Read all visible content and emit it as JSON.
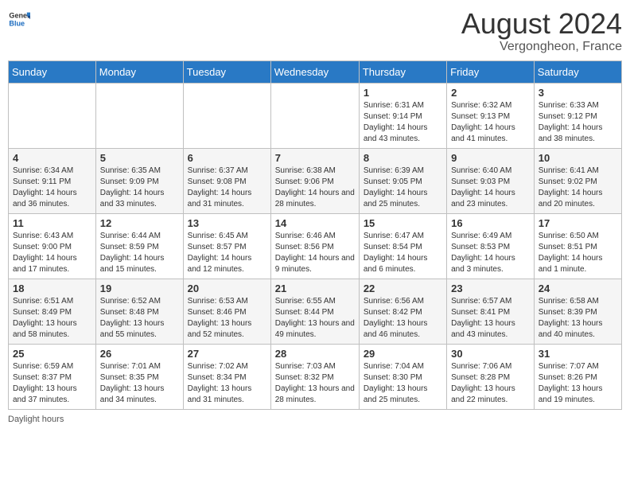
{
  "header": {
    "logo_general": "General",
    "logo_blue": "Blue",
    "month": "August 2024",
    "location": "Vergongheon, France"
  },
  "weekdays": [
    "Sunday",
    "Monday",
    "Tuesday",
    "Wednesday",
    "Thursday",
    "Friday",
    "Saturday"
  ],
  "weeks": [
    [
      {
        "day": "",
        "info": ""
      },
      {
        "day": "",
        "info": ""
      },
      {
        "day": "",
        "info": ""
      },
      {
        "day": "",
        "info": ""
      },
      {
        "day": "1",
        "info": "Sunrise: 6:31 AM\nSunset: 9:14 PM\nDaylight: 14 hours and 43 minutes."
      },
      {
        "day": "2",
        "info": "Sunrise: 6:32 AM\nSunset: 9:13 PM\nDaylight: 14 hours and 41 minutes."
      },
      {
        "day": "3",
        "info": "Sunrise: 6:33 AM\nSunset: 9:12 PM\nDaylight: 14 hours and 38 minutes."
      }
    ],
    [
      {
        "day": "4",
        "info": "Sunrise: 6:34 AM\nSunset: 9:11 PM\nDaylight: 14 hours and 36 minutes."
      },
      {
        "day": "5",
        "info": "Sunrise: 6:35 AM\nSunset: 9:09 PM\nDaylight: 14 hours and 33 minutes."
      },
      {
        "day": "6",
        "info": "Sunrise: 6:37 AM\nSunset: 9:08 PM\nDaylight: 14 hours and 31 minutes."
      },
      {
        "day": "7",
        "info": "Sunrise: 6:38 AM\nSunset: 9:06 PM\nDaylight: 14 hours and 28 minutes."
      },
      {
        "day": "8",
        "info": "Sunrise: 6:39 AM\nSunset: 9:05 PM\nDaylight: 14 hours and 25 minutes."
      },
      {
        "day": "9",
        "info": "Sunrise: 6:40 AM\nSunset: 9:03 PM\nDaylight: 14 hours and 23 minutes."
      },
      {
        "day": "10",
        "info": "Sunrise: 6:41 AM\nSunset: 9:02 PM\nDaylight: 14 hours and 20 minutes."
      }
    ],
    [
      {
        "day": "11",
        "info": "Sunrise: 6:43 AM\nSunset: 9:00 PM\nDaylight: 14 hours and 17 minutes."
      },
      {
        "day": "12",
        "info": "Sunrise: 6:44 AM\nSunset: 8:59 PM\nDaylight: 14 hours and 15 minutes."
      },
      {
        "day": "13",
        "info": "Sunrise: 6:45 AM\nSunset: 8:57 PM\nDaylight: 14 hours and 12 minutes."
      },
      {
        "day": "14",
        "info": "Sunrise: 6:46 AM\nSunset: 8:56 PM\nDaylight: 14 hours and 9 minutes."
      },
      {
        "day": "15",
        "info": "Sunrise: 6:47 AM\nSunset: 8:54 PM\nDaylight: 14 hours and 6 minutes."
      },
      {
        "day": "16",
        "info": "Sunrise: 6:49 AM\nSunset: 8:53 PM\nDaylight: 14 hours and 3 minutes."
      },
      {
        "day": "17",
        "info": "Sunrise: 6:50 AM\nSunset: 8:51 PM\nDaylight: 14 hours and 1 minute."
      }
    ],
    [
      {
        "day": "18",
        "info": "Sunrise: 6:51 AM\nSunset: 8:49 PM\nDaylight: 13 hours and 58 minutes."
      },
      {
        "day": "19",
        "info": "Sunrise: 6:52 AM\nSunset: 8:48 PM\nDaylight: 13 hours and 55 minutes."
      },
      {
        "day": "20",
        "info": "Sunrise: 6:53 AM\nSunset: 8:46 PM\nDaylight: 13 hours and 52 minutes."
      },
      {
        "day": "21",
        "info": "Sunrise: 6:55 AM\nSunset: 8:44 PM\nDaylight: 13 hours and 49 minutes."
      },
      {
        "day": "22",
        "info": "Sunrise: 6:56 AM\nSunset: 8:42 PM\nDaylight: 13 hours and 46 minutes."
      },
      {
        "day": "23",
        "info": "Sunrise: 6:57 AM\nSunset: 8:41 PM\nDaylight: 13 hours and 43 minutes."
      },
      {
        "day": "24",
        "info": "Sunrise: 6:58 AM\nSunset: 8:39 PM\nDaylight: 13 hours and 40 minutes."
      }
    ],
    [
      {
        "day": "25",
        "info": "Sunrise: 6:59 AM\nSunset: 8:37 PM\nDaylight: 13 hours and 37 minutes."
      },
      {
        "day": "26",
        "info": "Sunrise: 7:01 AM\nSunset: 8:35 PM\nDaylight: 13 hours and 34 minutes."
      },
      {
        "day": "27",
        "info": "Sunrise: 7:02 AM\nSunset: 8:34 PM\nDaylight: 13 hours and 31 minutes."
      },
      {
        "day": "28",
        "info": "Sunrise: 7:03 AM\nSunset: 8:32 PM\nDaylight: 13 hours and 28 minutes."
      },
      {
        "day": "29",
        "info": "Sunrise: 7:04 AM\nSunset: 8:30 PM\nDaylight: 13 hours and 25 minutes."
      },
      {
        "day": "30",
        "info": "Sunrise: 7:06 AM\nSunset: 8:28 PM\nDaylight: 13 hours and 22 minutes."
      },
      {
        "day": "31",
        "info": "Sunrise: 7:07 AM\nSunset: 8:26 PM\nDaylight: 13 hours and 19 minutes."
      }
    ]
  ],
  "footer": {
    "note": "Daylight hours"
  }
}
